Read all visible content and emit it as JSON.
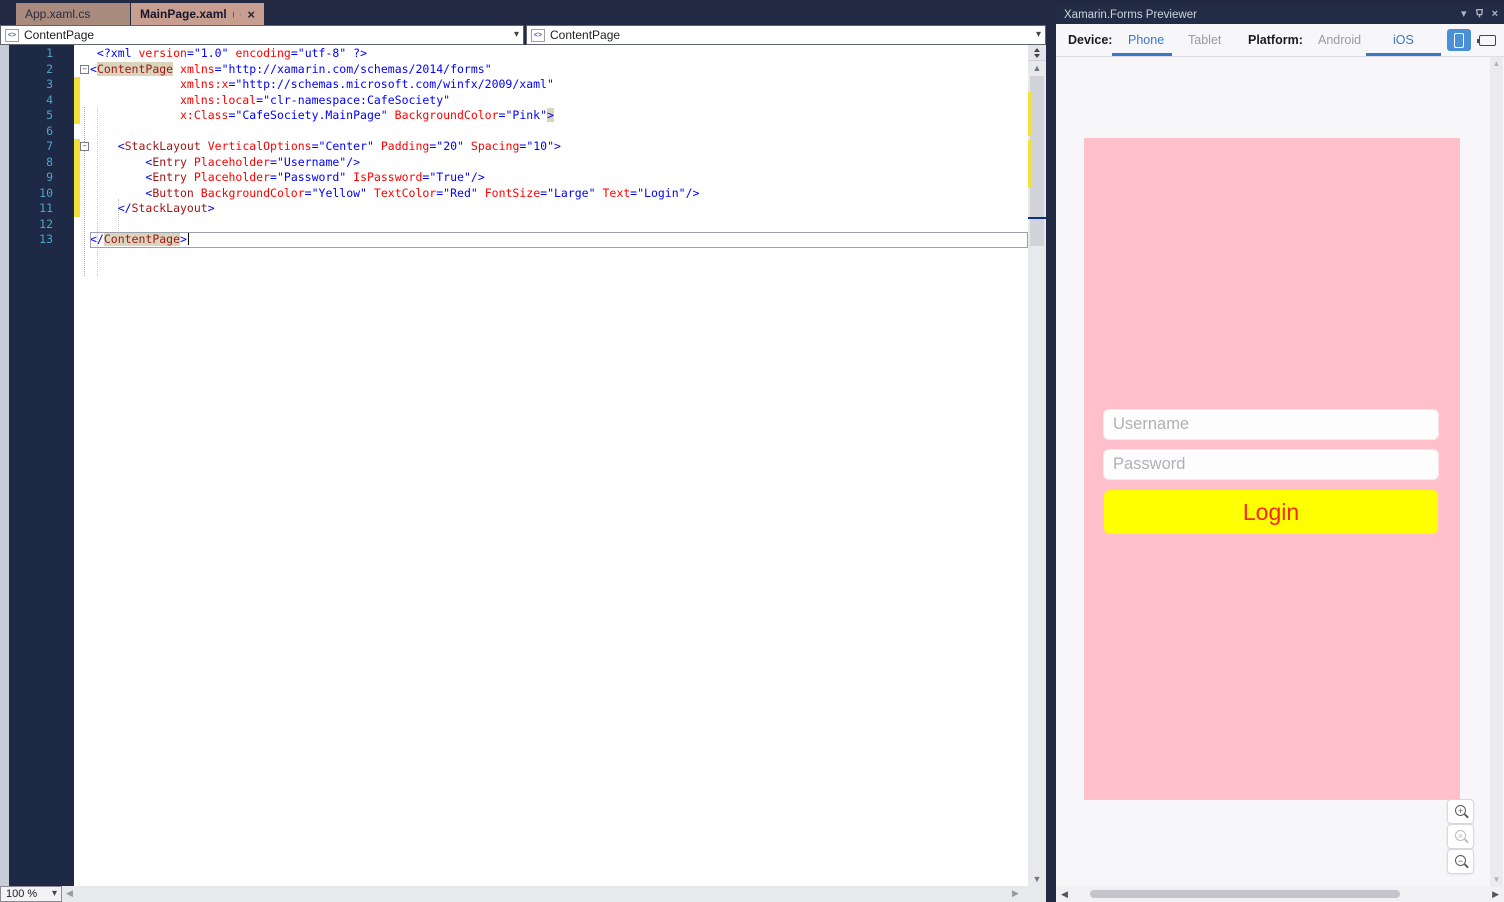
{
  "tabs": [
    {
      "label": "App.xaml.cs",
      "active": false,
      "modified": false
    },
    {
      "label": "MainPage.xaml",
      "active": true,
      "modified": true
    }
  ],
  "editor": {
    "breadcrumbs": {
      "left": "ContentPage",
      "right": "ContentPage"
    },
    "code": {
      "lines": [
        {
          "num": 1,
          "indent": 1,
          "changed": false,
          "fold": false,
          "current": false,
          "caret": false,
          "tokens": [
            {
              "t": "d",
              "s": "<?xml "
            },
            {
              "t": "a",
              "s": "version"
            },
            {
              "t": "d",
              "s": "="
            },
            {
              "t": "v",
              "s": "\"1.0\""
            },
            {
              "t": "p",
              "s": " "
            },
            {
              "t": "a",
              "s": "encoding"
            },
            {
              "t": "d",
              "s": "="
            },
            {
              "t": "v",
              "s": "\"utf-8\""
            },
            {
              "t": "d",
              "s": " ?>"
            }
          ]
        },
        {
          "num": 2,
          "indent": 0,
          "changed": false,
          "fold": true,
          "current": false,
          "caret": false,
          "tokens": [
            {
              "t": "d",
              "s": "<"
            },
            {
              "t": "t",
              "s": "ContentPage",
              "hl": true
            },
            {
              "t": "p",
              "s": " "
            },
            {
              "t": "a",
              "s": "xmlns"
            },
            {
              "t": "d",
              "s": "="
            },
            {
              "t": "v",
              "s": "\"http://xamarin.com/schemas/2014/forms\""
            }
          ]
        },
        {
          "num": 3,
          "indent": 13,
          "changed": true,
          "fold": false,
          "current": false,
          "caret": false,
          "tokens": [
            {
              "t": "a",
              "s": "xmlns:x"
            },
            {
              "t": "d",
              "s": "="
            },
            {
              "t": "v",
              "s": "\"http://schemas.microsoft.com/winfx/2009/xaml\""
            }
          ]
        },
        {
          "num": 4,
          "indent": 13,
          "changed": true,
          "fold": false,
          "current": false,
          "caret": false,
          "tokens": [
            {
              "t": "a",
              "s": "xmlns:local"
            },
            {
              "t": "d",
              "s": "="
            },
            {
              "t": "v",
              "s": "\"clr-namespace:CafeSociety\""
            }
          ]
        },
        {
          "num": 5,
          "indent": 13,
          "changed": true,
          "fold": false,
          "current": false,
          "caret": false,
          "tokens": [
            {
              "t": "a",
              "s": "x:Class"
            },
            {
              "t": "d",
              "s": "="
            },
            {
              "t": "v",
              "s": "\"CafeSociety.MainPage\""
            },
            {
              "t": "p",
              "s": " "
            },
            {
              "t": "a",
              "s": "BackgroundColor"
            },
            {
              "t": "d",
              "s": "="
            },
            {
              "t": "v",
              "s": "\"Pink\""
            },
            {
              "t": "d",
              "s": ">",
              "hl": true
            }
          ]
        },
        {
          "num": 6,
          "indent": 0,
          "changed": false,
          "fold": false,
          "current": false,
          "caret": false,
          "tokens": []
        },
        {
          "num": 7,
          "indent": 4,
          "changed": true,
          "fold": true,
          "current": false,
          "caret": false,
          "tokens": [
            {
              "t": "d",
              "s": "<"
            },
            {
              "t": "t",
              "s": "StackLayout"
            },
            {
              "t": "p",
              "s": " "
            },
            {
              "t": "a",
              "s": "VerticalOptions"
            },
            {
              "t": "d",
              "s": "="
            },
            {
              "t": "v",
              "s": "\"Center\""
            },
            {
              "t": "p",
              "s": " "
            },
            {
              "t": "a",
              "s": "Padding"
            },
            {
              "t": "d",
              "s": "="
            },
            {
              "t": "v",
              "s": "\"20\""
            },
            {
              "t": "p",
              "s": " "
            },
            {
              "t": "a",
              "s": "Spacing"
            },
            {
              "t": "d",
              "s": "="
            },
            {
              "t": "v",
              "s": "\"10\""
            },
            {
              "t": "d",
              "s": ">"
            }
          ]
        },
        {
          "num": 8,
          "indent": 8,
          "changed": true,
          "fold": false,
          "current": false,
          "caret": false,
          "tokens": [
            {
              "t": "d",
              "s": "<"
            },
            {
              "t": "t",
              "s": "Entry"
            },
            {
              "t": "p",
              "s": " "
            },
            {
              "t": "a",
              "s": "Placeholder"
            },
            {
              "t": "d",
              "s": "="
            },
            {
              "t": "v",
              "s": "\"Username\""
            },
            {
              "t": "d",
              "s": "/>"
            }
          ]
        },
        {
          "num": 9,
          "indent": 8,
          "changed": true,
          "fold": false,
          "current": false,
          "caret": false,
          "tokens": [
            {
              "t": "d",
              "s": "<"
            },
            {
              "t": "t",
              "s": "Entry"
            },
            {
              "t": "p",
              "s": " "
            },
            {
              "t": "a",
              "s": "Placeholder"
            },
            {
              "t": "d",
              "s": "="
            },
            {
              "t": "v",
              "s": "\"Password\""
            },
            {
              "t": "p",
              "s": " "
            },
            {
              "t": "a",
              "s": "IsPassword"
            },
            {
              "t": "d",
              "s": "="
            },
            {
              "t": "v",
              "s": "\"True\""
            },
            {
              "t": "d",
              "s": "/>"
            }
          ]
        },
        {
          "num": 10,
          "indent": 8,
          "changed": true,
          "fold": false,
          "current": false,
          "caret": false,
          "tokens": [
            {
              "t": "d",
              "s": "<"
            },
            {
              "t": "t",
              "s": "Button"
            },
            {
              "t": "p",
              "s": " "
            },
            {
              "t": "a",
              "s": "BackgroundColor"
            },
            {
              "t": "d",
              "s": "="
            },
            {
              "t": "v",
              "s": "\"Yellow\""
            },
            {
              "t": "p",
              "s": " "
            },
            {
              "t": "a",
              "s": "TextColor"
            },
            {
              "t": "d",
              "s": "="
            },
            {
              "t": "v",
              "s": "\"Red\""
            },
            {
              "t": "p",
              "s": " "
            },
            {
              "t": "a",
              "s": "FontSize"
            },
            {
              "t": "d",
              "s": "="
            },
            {
              "t": "v",
              "s": "\"Large\""
            },
            {
              "t": "p",
              "s": " "
            },
            {
              "t": "a",
              "s": "Text"
            },
            {
              "t": "d",
              "s": "="
            },
            {
              "t": "v",
              "s": "\"Login\""
            },
            {
              "t": "d",
              "s": "/>"
            }
          ]
        },
        {
          "num": 11,
          "indent": 4,
          "changed": true,
          "fold": false,
          "current": false,
          "caret": false,
          "tokens": [
            {
              "t": "d",
              "s": "</"
            },
            {
              "t": "t",
              "s": "StackLayout"
            },
            {
              "t": "d",
              "s": ">"
            }
          ]
        },
        {
          "num": 12,
          "indent": 0,
          "changed": false,
          "fold": false,
          "current": false,
          "caret": false,
          "tokens": []
        },
        {
          "num": 13,
          "indent": 0,
          "changed": false,
          "fold": false,
          "current": true,
          "caret": true,
          "tokens": [
            {
              "t": "d",
              "s": "</"
            },
            {
              "t": "t",
              "s": "ContentPage",
              "hl": true
            },
            {
              "t": "d",
              "s": ">"
            }
          ]
        }
      ]
    }
  },
  "statusbar": {
    "zoom_level": "100 %"
  },
  "previewer": {
    "title": "Xamarin.Forms Previewer",
    "toolbar": {
      "device_label": "Device:",
      "device_options": [
        {
          "label": "Phone",
          "selected": true
        },
        {
          "label": "Tablet",
          "selected": false
        }
      ],
      "platform_label": "Platform:",
      "platform_options": [
        {
          "label": "Android",
          "selected": false
        },
        {
          "label": "iOS",
          "selected": true
        }
      ]
    },
    "preview": {
      "page_background": "#FFC0CB",
      "entries": [
        {
          "placeholder": "Username"
        },
        {
          "placeholder": "Password"
        }
      ],
      "button": {
        "label": "Login",
        "background": "#FFFF00",
        "text_color": "#F5281B"
      }
    },
    "colors": {
      "accent_blue": "#3A77C4",
      "orientation_button_blue": "#4A90D9"
    }
  }
}
